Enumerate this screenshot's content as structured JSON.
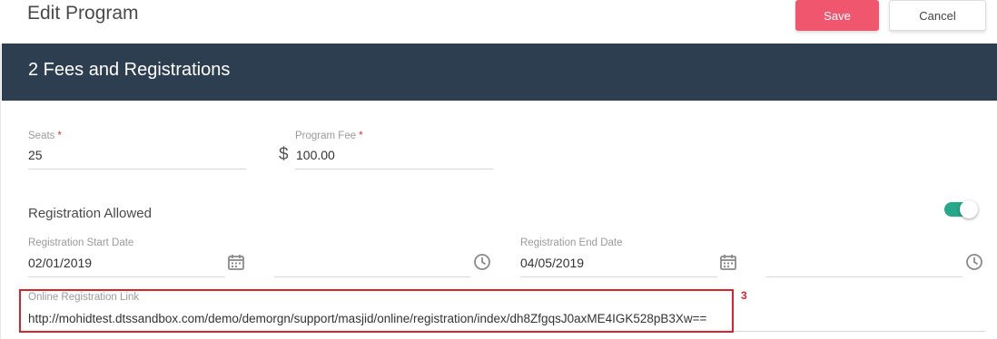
{
  "header": {
    "title": "Edit Program",
    "save_label": "Save",
    "cancel_label": "Cancel"
  },
  "section": {
    "title": "2 Fees and Registrations"
  },
  "fields": {
    "seats": {
      "label": "Seats",
      "required_mark": "*",
      "value": "25"
    },
    "program_fee": {
      "label": "Program Fee",
      "required_mark": "*",
      "currency": "$",
      "value": "100.00"
    },
    "registration_allowed": {
      "label": "Registration Allowed",
      "enabled": true
    },
    "registration_start_date": {
      "label": "Registration Start Date",
      "value": "02/01/2019",
      "time": ""
    },
    "registration_end_date": {
      "label": "Registration End Date",
      "value": "04/05/2019",
      "time": ""
    },
    "online_registration_link": {
      "label": "Online Registration Link",
      "value": "http://mohidtest.dtssandbox.com/demo/demorgn/support/masjid/online/registration/index/dh8ZfgqsJ0axME4IGK528pB3Xw=="
    }
  },
  "annotation": {
    "marker": "3",
    "color": "#d9242f"
  },
  "colors": {
    "save_button": "#f0566e",
    "section_header": "#2d3e50",
    "toggle_on": "#26a98a"
  },
  "icons": {
    "start_date": "calendar-icon",
    "start_time": "clock-icon",
    "end_date": "calendar-icon",
    "end_time": "clock-icon"
  }
}
